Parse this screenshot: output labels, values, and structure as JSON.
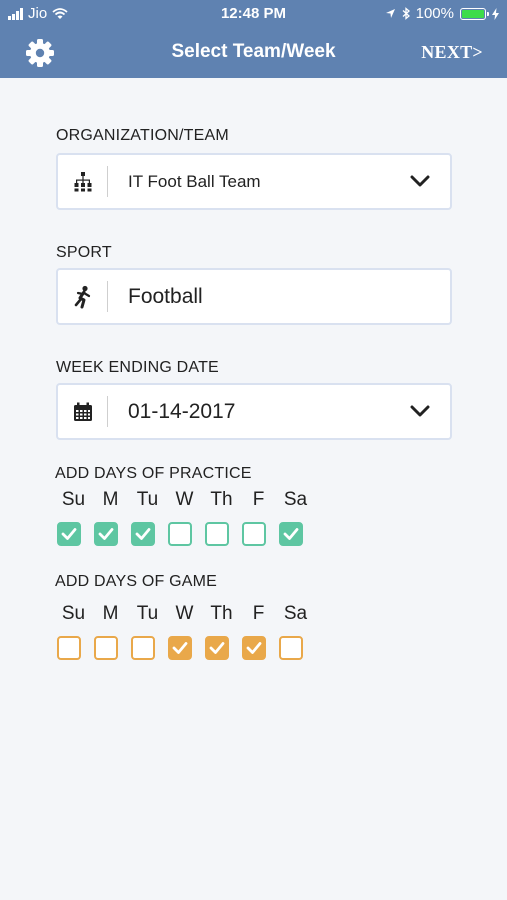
{
  "status": {
    "carrier": "Jio",
    "time": "12:48 PM",
    "battery": "100%"
  },
  "nav": {
    "title": "Select Team/Week",
    "next": "NEXT>"
  },
  "org": {
    "label": "ORGANIZATION/TEAM",
    "value": "IT Foot Ball Team"
  },
  "sport": {
    "label": "SPORT",
    "value": "Football"
  },
  "week": {
    "label": "WEEK ENDING DATE",
    "value": "01-14-2017"
  },
  "practice": {
    "label": "ADD DAYS OF PRACTICE",
    "days": [
      "Su",
      "M",
      "Tu",
      "W",
      "Th",
      "F",
      "Sa"
    ],
    "checked": [
      true,
      true,
      true,
      false,
      false,
      false,
      true
    ]
  },
  "game": {
    "label": "ADD DAYS OF GAME",
    "days": [
      "Su",
      "M",
      "Tu",
      "W",
      "Th",
      "F",
      "Sa"
    ],
    "checked": [
      false,
      false,
      false,
      true,
      true,
      true,
      false
    ]
  },
  "colors": {
    "header": "#5f82b1",
    "practice": "#5ec6a2",
    "game": "#e9a84a"
  }
}
